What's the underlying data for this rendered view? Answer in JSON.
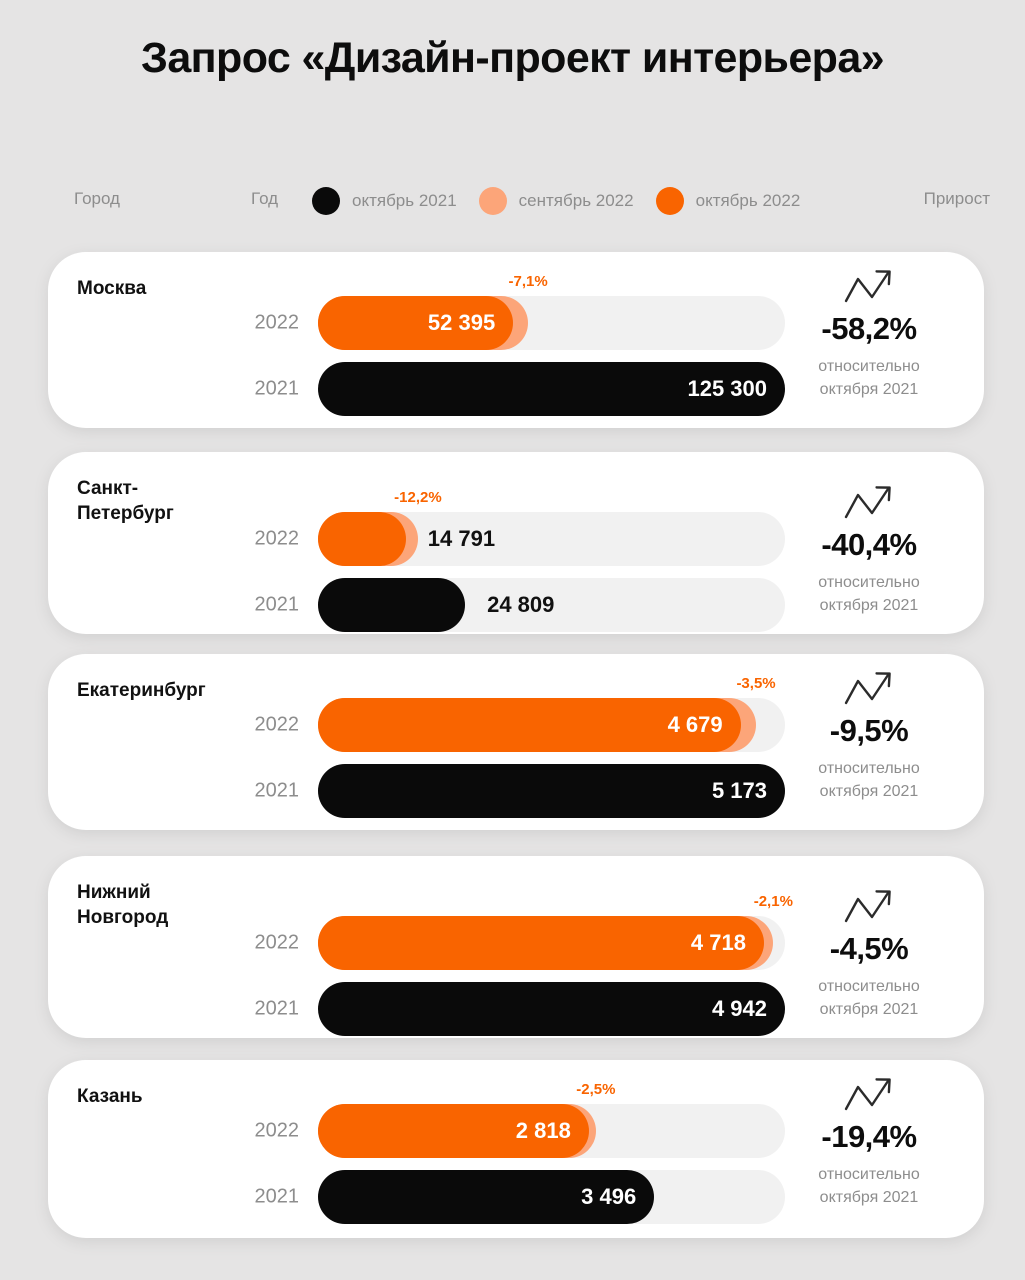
{
  "title": "Запрос «Дизайн-проект интерьера»",
  "header": {
    "city_label": "Город",
    "year_label": "Год",
    "growth_label": "Прирост"
  },
  "legend": [
    {
      "label": "октябрь 2021",
      "color": "#0a0a0a",
      "icon": "legend-dot-oct-2021"
    },
    {
      "label": "сентябрь 2022",
      "color": "#fca579",
      "icon": "legend-dot-sep-2022"
    },
    {
      "label": "октябрь 2022",
      "color": "#f96400",
      "icon": "legend-dot-oct-2022"
    }
  ],
  "colors": {
    "background": "#e5e4e4",
    "card": "#ffffff",
    "track": "#f1f1f1",
    "oct_2021": "#0a0a0a",
    "sep_2022": "#fca579",
    "oct_2022": "#f96400",
    "muted_text": "#8d8d8d"
  },
  "growth_note": "относительно\nоктября 2021",
  "growth_note_line1": "относительно",
  "growth_note_line2": "октября 2021",
  "cards": [
    {
      "city": "Москва",
      "year_2022": "2022",
      "year_2021": "2021",
      "value_2022": "52 395",
      "value_2021": "125 300",
      "month_change_pct": "-7,1%",
      "growth": "-58,2%",
      "value_2022_inside": true,
      "value_2021_inside": true
    },
    {
      "city": "Санкт-\nПетербург",
      "city_line1": "Санкт-",
      "city_line2": "Петербург",
      "year_2022": "2022",
      "year_2021": "2021",
      "value_2022": "14 791",
      "value_2021": "24 809",
      "month_change_pct": "-12,2%",
      "growth": "-40,4%",
      "value_2022_inside": false,
      "value_2021_inside": false
    },
    {
      "city": "Екатеринбург",
      "year_2022": "2022",
      "year_2021": "2021",
      "value_2022": "4 679",
      "value_2021": "5 173",
      "month_change_pct": "-3,5%",
      "growth": "-9,5%",
      "value_2022_inside": true,
      "value_2021_inside": true
    },
    {
      "city": "Нижний\nНовгород",
      "city_line1": "Нижний",
      "city_line2": "Новгород",
      "year_2022": "2022",
      "year_2021": "2021",
      "value_2022": "4 718",
      "value_2021": "4 942",
      "month_change_pct": "-2,1%",
      "growth": "-4,5%",
      "value_2022_inside": true,
      "value_2021_inside": true
    },
    {
      "city": "Казань",
      "year_2022": "2022",
      "year_2021": "2021",
      "value_2022": "2 818",
      "value_2021": "3 496",
      "month_change_pct": "-2,5%",
      "growth": "-19,4%",
      "value_2022_inside": true,
      "value_2021_inside": true
    }
  ],
  "chart_data": {
    "type": "bar",
    "title": "Запрос «Дизайн-проект интерьера»",
    "xlabel": "",
    "ylabel": "",
    "orientation": "horizontal",
    "grid": false,
    "legend_position": "top",
    "categories": [
      "Москва",
      "Санкт-Петербург",
      "Екатеринбург",
      "Нижний Новгород",
      "Казань"
    ],
    "series": [
      {
        "name": "октябрь 2021",
        "color": "#0a0a0a",
        "values": [
          125300,
          24809,
          5173,
          4942,
          3496
        ]
      },
      {
        "name": "сентябрь 2022",
        "color": "#fca579",
        "values": [
          56390,
          16846,
          4849,
          4819,
          2890
        ]
      },
      {
        "name": "октябрь 2022",
        "color": "#f96400",
        "values": [
          52395,
          14791,
          4679,
          4718,
          2818
        ]
      }
    ],
    "annotations": [
      {
        "category": "Москва",
        "month_change_pct": -7.1,
        "growth_vs_oct_2021_pct": -58.2
      },
      {
        "category": "Санкт-Петербург",
        "month_change_pct": -12.2,
        "growth_vs_oct_2021_pct": -40.4
      },
      {
        "category": "Екатеринбург",
        "month_change_pct": -3.5,
        "growth_vs_oct_2021_pct": -9.5
      },
      {
        "category": "Нижний Новгород",
        "month_change_pct": -2.1,
        "growth_vs_oct_2021_pct": -4.5
      },
      {
        "category": "Казань",
        "month_change_pct": -2.5,
        "growth_vs_oct_2021_pct": -19.4
      }
    ],
    "note": "Прирост относительно октября 2021"
  },
  "layout": {
    "card_tops": [
      252,
      452,
      654,
      856,
      1060
    ],
    "card_heights": [
      176,
      182,
      176,
      182,
      178
    ],
    "bar_scales": [
      {
        "track_pct_2021": 100.0,
        "main_2022_pct": 41.8,
        "sep_2022_pct": 45.0
      },
      {
        "track_pct_2021": 31.5,
        "main_2022_pct": 18.8,
        "sep_2022_pct": 21.4
      },
      {
        "track_pct_2021": 100.0,
        "main_2022_pct": 90.5,
        "sep_2022_pct": 93.8
      },
      {
        "track_pct_2021": 100.0,
        "main_2022_pct": 95.5,
        "sep_2022_pct": 97.5
      },
      {
        "track_pct_2021": 72.0,
        "main_2022_pct": 58.0,
        "sep_2022_pct": 59.5
      }
    ]
  }
}
